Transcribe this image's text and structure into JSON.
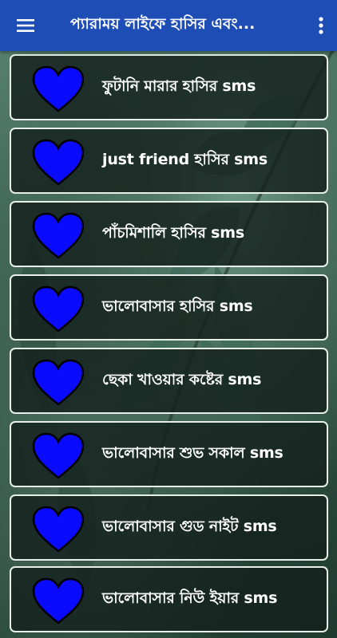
{
  "app": {
    "title": "প্যারাময় লাইফে হাসির এবং...",
    "accent_color": "#1f4db6",
    "menu_icon": "hamburger-menu-icon",
    "more_icon": "more-vert-icon"
  },
  "items": [
    {
      "label": "ফুটানি মারার হাসির sms",
      "icon": "heart-icon"
    },
    {
      "label": "just friend হাসির sms",
      "icon": "heart-icon"
    },
    {
      "label": "পাঁচমিশালি হাসির sms",
      "icon": "heart-icon"
    },
    {
      "label": "ভালোবাসার হাসির sms",
      "icon": "heart-icon"
    },
    {
      "label": "ছেকা খাওয়ার কষ্টের sms",
      "icon": "heart-icon"
    },
    {
      "label": "ভালোবাসার শুভ সকাল sms",
      "icon": "heart-icon"
    },
    {
      "label": "ভালোবাসার গুড নাইট sms",
      "icon": "heart-icon"
    },
    {
      "label": "ভালোবাসার নিউ ইয়ার sms",
      "icon": "heart-icon"
    }
  ],
  "colors": {
    "heart_fill": "#0a0aff",
    "heart_stroke": "#000000",
    "item_border": "#e8efe9"
  }
}
